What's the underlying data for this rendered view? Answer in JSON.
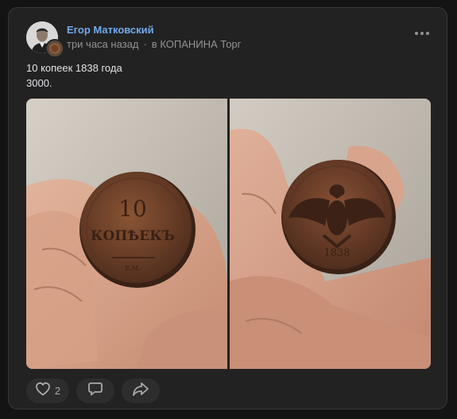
{
  "post": {
    "author": "Егор Матковский",
    "time": "три часа назад",
    "separator": "·",
    "group": "в КОПАНИНА Торг",
    "text_line1": "10 копеек 1838 года",
    "text_line2": "3000.",
    "photo_count": 2
  },
  "coin": {
    "obverse_value": "10",
    "obverse_word": "КОПѢЕКЪ",
    "obverse_mint": "Е.М.",
    "reverse_year": "1838"
  },
  "actions": {
    "like_count": "2"
  },
  "colors": {
    "background": "#141414",
    "card": "#222222",
    "author_link": "#71aaeb",
    "muted_text": "#939393",
    "button_bg": "#2d2d2d"
  },
  "icons": [
    "more-icon",
    "heart-icon",
    "comment-icon",
    "share-icon"
  ]
}
